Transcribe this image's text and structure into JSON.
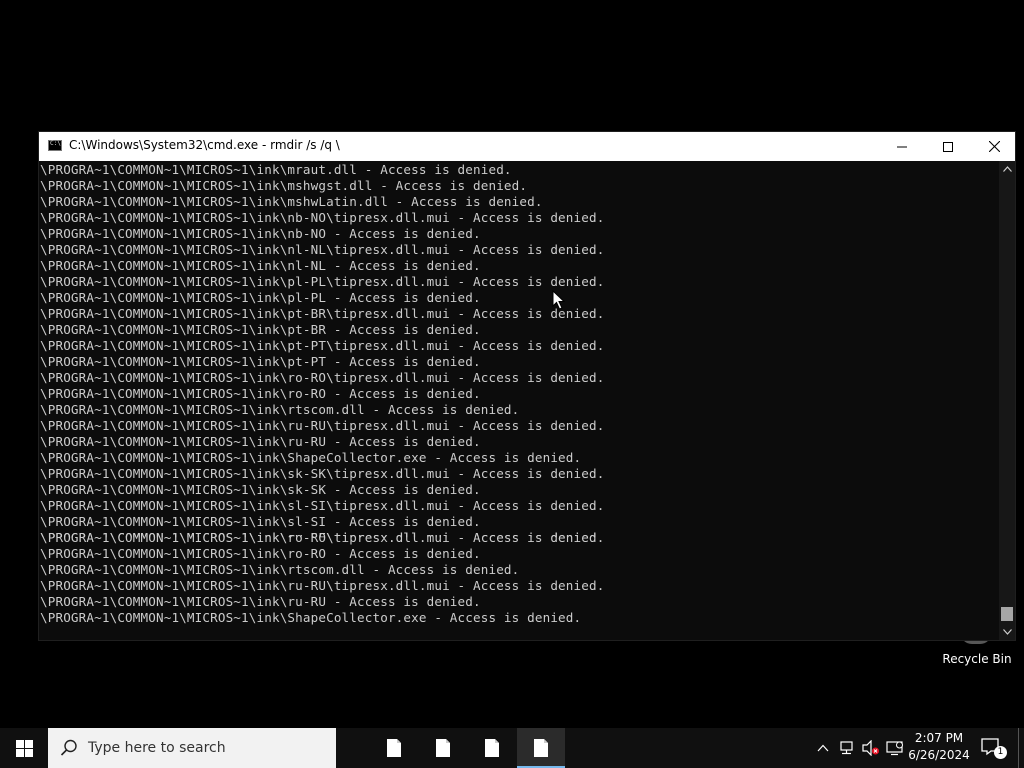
{
  "window": {
    "title": "C:\\Windows\\System32\\cmd.exe - rmdir  /s /q \\"
  },
  "console": {
    "lines": [
      "\\PROGRA~1\\COMMON~1\\MICROS~1\\ink\\mraut.dll - Access is denied.",
      "\\PROGRA~1\\COMMON~1\\MICROS~1\\ink\\mshwgst.dll - Access is denied.",
      "\\PROGRA~1\\COMMON~1\\MICROS~1\\ink\\mshwLatin.dll - Access is denied.",
      "\\PROGRA~1\\COMMON~1\\MICROS~1\\ink\\nb-NO\\tipresx.dll.mui - Access is denied.",
      "\\PROGRA~1\\COMMON~1\\MICROS~1\\ink\\nb-NO - Access is denied.",
      "\\PROGRA~1\\COMMON~1\\MICROS~1\\ink\\nl-NL\\tipresx.dll.mui - Access is denied.",
      "\\PROGRA~1\\COMMON~1\\MICROS~1\\ink\\nl-NL - Access is denied.",
      "\\PROGRA~1\\COMMON~1\\MICROS~1\\ink\\pl-PL\\tipresx.dll.mui - Access is denied.",
      "\\PROGRA~1\\COMMON~1\\MICROS~1\\ink\\pl-PL - Access is denied.",
      "\\PROGRA~1\\COMMON~1\\MICROS~1\\ink\\pt-BR\\tipresx.dll.mui - Access is denied.",
      "\\PROGRA~1\\COMMON~1\\MICROS~1\\ink\\pt-BR - Access is denied.",
      "\\PROGRA~1\\COMMON~1\\MICROS~1\\ink\\pt-PT\\tipresx.dll.mui - Access is denied.",
      "\\PROGRA~1\\COMMON~1\\MICROS~1\\ink\\pt-PT - Access is denied.",
      "\\PROGRA~1\\COMMON~1\\MICROS~1\\ink\\ro-RO\\tipresx.dll.mui - Access is denied.",
      "\\PROGRA~1\\COMMON~1\\MICROS~1\\ink\\ro-RO - Access is denied.",
      "\\PROGRA~1\\COMMON~1\\MICROS~1\\ink\\rtscom.dll - Access is denied.",
      "\\PROGRA~1\\COMMON~1\\MICROS~1\\ink\\ru-RU\\tipresx.dll.mui - Access is denied.",
      "\\PROGRA~1\\COMMON~1\\MICROS~1\\ink\\ru-RU - Access is denied.",
      "\\PROGRA~1\\COMMON~1\\MICROS~1\\ink\\ShapeCollector.exe - Access is denied.",
      "\\PROGRA~1\\COMMON~1\\MICROS~1\\ink\\sk-SK\\tipresx.dll.mui - Access is denied.",
      "\\PROGRA~1\\COMMON~1\\MICROS~1\\ink\\sk-SK - Access is denied.",
      "\\PROGRA~1\\COMMON~1\\MICROS~1\\ink\\sl-SI\\tipresx.dll.mui - Access is denied.",
      "\\PROGRA~1\\COMMON~1\\MICROS~1\\ink\\sl-SI - Access is denied.",
      "\\PROGRA~1\\COMMON~1\\MICROS~1\\ink\\ro-RO\\tipresx.dll.mui - Access is denied.",
      "\\PROGRA~1\\COMMON~1\\MICROS~1\\ink\\ro-RO - Access is denied.",
      "\\PROGRA~1\\COMMON~1\\MICROS~1\\ink\\rtscom.dll - Access is denied.",
      "\\PROGRA~1\\COMMON~1\\MICROS~1\\ink\\ru-RU\\tipresx.dll.mui - Access is denied.",
      "\\PROGRA~1\\COMMON~1\\MICROS~1\\ink\\ru-RU - Access is denied.",
      "\\PROGRA~1\\COMMON~1\\MICROS~1\\ink\\ShapeCollector.exe - Access is denied."
    ],
    "garbled_overlay": "\\PROGRA~1\\COMMON~1\\MICROS~1\\ink\\sv-SE\\tipresx.dll.mui - Access is denied."
  },
  "desktop": {
    "recycle_bin_label": "Recycle Bin"
  },
  "taskbar": {
    "search_placeholder": "Type here to search",
    "time": "2:07 PM",
    "date": "6/26/2024",
    "notification_count": "1"
  },
  "colors": {
    "console_bg": "#0c0c0c",
    "console_text": "#cccccc",
    "taskbar_bg": "#101010",
    "accent": "#76b9ed"
  }
}
